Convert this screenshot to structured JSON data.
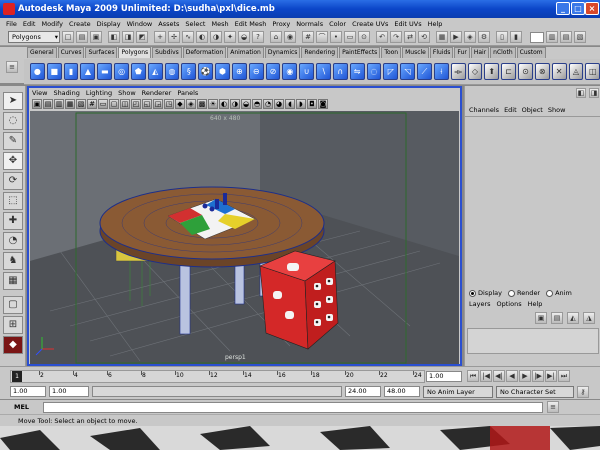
{
  "window": {
    "title": "Autodesk Maya 2009 Unlimited: D:\\sudha\\pxl\\dice.mb",
    "min": "_",
    "max": "□",
    "close": "×"
  },
  "menubar": [
    "File",
    "Edit",
    "Modify",
    "Create",
    "Display",
    "Window",
    "Assets",
    "Select",
    "Mesh",
    "Edit Mesh",
    "Proxy",
    "Normals",
    "Color",
    "Create UVs",
    "Edit UVs",
    "Help"
  ],
  "status": {
    "menuset": "Polygons"
  },
  "shelf": {
    "tabs": [
      "General",
      "Curves",
      "Surfaces",
      "Polygons",
      "Subdivs",
      "Deformation",
      "Animation",
      "Dynamics",
      "Rendering",
      "PaintEffects",
      "Toon",
      "Muscle",
      "Fluids",
      "Fur",
      "Hair",
      "nCloth",
      "Custom"
    ],
    "active_tab": "Polygons"
  },
  "panel": {
    "menus": [
      "View",
      "Shading",
      "Lighting",
      "Show",
      "Renderer",
      "Panels"
    ],
    "resolution_gate": "640 x 480",
    "camera": "persp1"
  },
  "channelbox": {
    "menus": [
      "Channels",
      "Edit",
      "Object",
      "Show"
    ],
    "display_options": [
      "Display",
      "Render",
      "Anim"
    ],
    "selected_display": "Display",
    "layer_menus": [
      "Layers",
      "Options",
      "Help"
    ]
  },
  "timeline": {
    "ticks": [
      "1",
      "2",
      "4",
      "6",
      "8",
      "10",
      "12",
      "14",
      "16",
      "18",
      "20",
      "22",
      "24"
    ],
    "current_frame": "1",
    "current_field": "1.00"
  },
  "range": {
    "start": "1.00",
    "playback_start": "1.00",
    "playback_end": "24.00",
    "end": "48.00",
    "anim_layer": "No Anim Layer",
    "character_set": "No Character Set"
  },
  "command": {
    "label": "MEL"
  },
  "help": {
    "text": "Move Tool: Select an object to move."
  },
  "colors": {
    "titlebar": "#0b46c8",
    "active_panel_border": "#2a4fd0",
    "ui_gray": "#c8c8c8",
    "viewport_bg": "#5f6369"
  }
}
